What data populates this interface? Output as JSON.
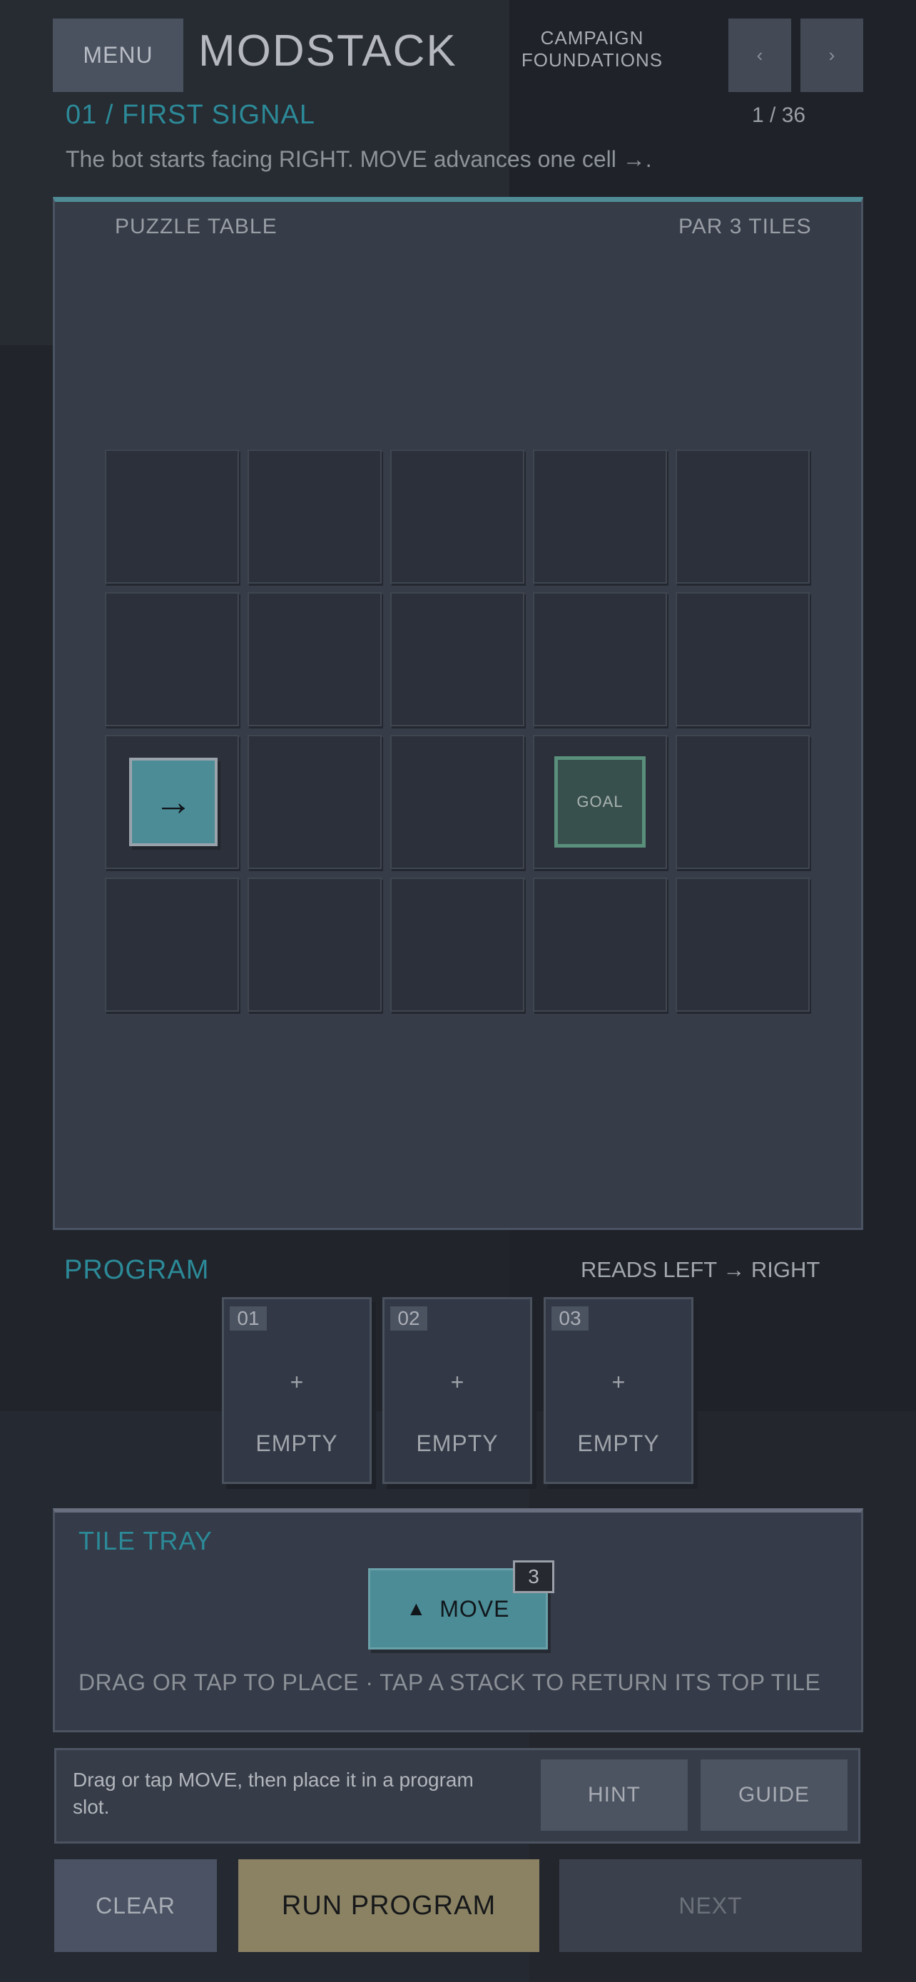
{
  "header": {
    "menu_label": "MENU",
    "app_title": "MODSTACK",
    "campaign_line1": "CAMPAIGN",
    "campaign_line2": "FOUNDATIONS",
    "prev_label": "‹",
    "next_label": "›"
  },
  "level": {
    "title": "01 / FIRST SIGNAL",
    "counter": "1 / 36",
    "description": "The bot starts facing RIGHT. MOVE advances one cell →."
  },
  "board": {
    "label": "PUZZLE TABLE",
    "par": "PAR 3 TILES",
    "rows": 4,
    "cols": 5,
    "bot": {
      "row": 2,
      "col": 0,
      "glyph": "→",
      "facing": "right"
    },
    "goal": {
      "row": 2,
      "col": 3,
      "label": "GOAL"
    }
  },
  "program": {
    "title": "PROGRAM",
    "direction": "READS LEFT → RIGHT",
    "slots": [
      {
        "num": "01",
        "plus": "+",
        "state": "EMPTY"
      },
      {
        "num": "02",
        "plus": "+",
        "state": "EMPTY"
      },
      {
        "num": "03",
        "plus": "+",
        "state": "EMPTY"
      }
    ]
  },
  "tray": {
    "title": "TILE TRAY",
    "tile": {
      "icon": "▲",
      "label": "MOVE",
      "count": "3"
    },
    "hint": "DRAG OR TAP TO PLACE · TAP A STACK TO RETURN ITS TOP TILE"
  },
  "status": {
    "text": "Drag or tap MOVE, then place it in a program slot.",
    "hint_label": "HINT",
    "guide_label": "GUIDE"
  },
  "actions": {
    "clear_label": "CLEAR",
    "run_label": "RUN PROGRAM",
    "next_label": "NEXT"
  },
  "colors": {
    "accent": "#2c8a98",
    "bot_tile": "#4c8c97",
    "goal_border": "#5a8f7c",
    "run_button": "#8a8263",
    "background": "#23262e"
  }
}
